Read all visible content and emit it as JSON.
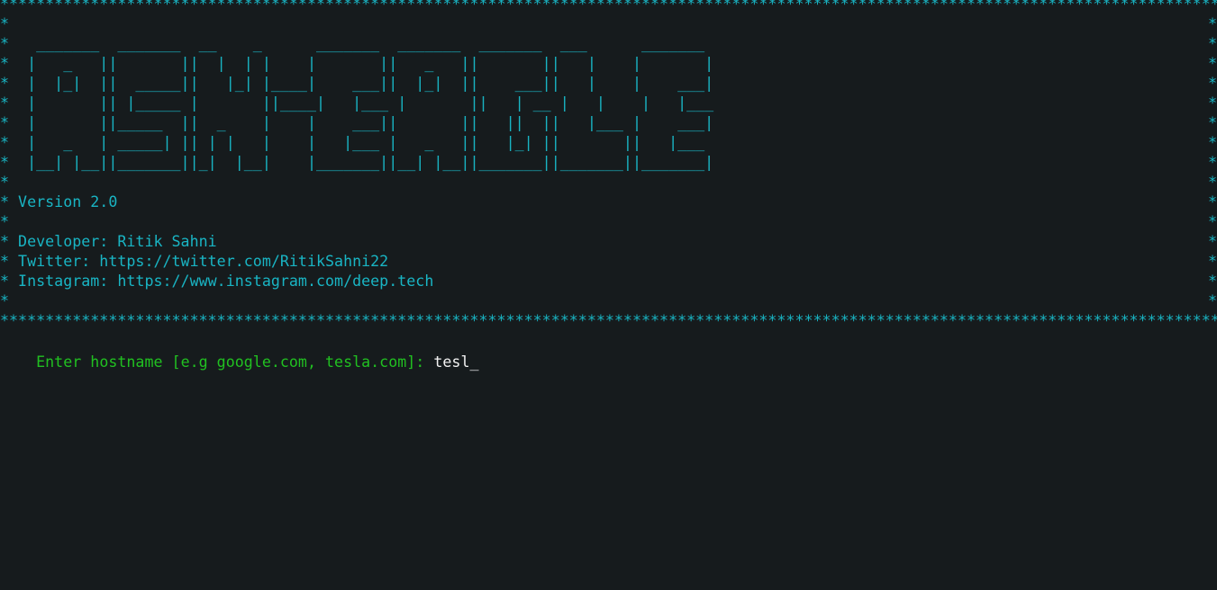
{
  "terminal": {
    "border_line": "*********************************************************************************************************************************************",
    "border_char": "*",
    "banner": [
      "",
      "   _______  _______  __    _      _______  _______  _______  ___      _______",
      "  |   _   ||       ||  |  | |    |       ||   _   ||       ||   |    |       |",
      "  |  |_|  ||  _____||   |_| |____|    ___||  |_|  ||    ___||   |    |    ___|",
      "  |       || |_____ |       ||____|   |___ |       ||   | __ |   |    |   |___",
      "  |       ||_____  ||  _    |    |    ___||       ||   ||  ||   |___ |    ___|",
      "  |   _   | _____| || | |   |    |   |___ |   _   ||   |_| ||       ||   |___",
      "  |__| |__||_______||_|  |__|    |_______||__| |__||_______||_______||_______|",
      "",
      " Version 2.0",
      "",
      " Developer: Ritik Sahni",
      " Twitter: https://twitter.com/RitikSahni22",
      " Instagram: https://www.instagram.com/deep.tech",
      ""
    ],
    "prompt": {
      "label": "Enter hostname [e.g google.com, tesla.com]: ",
      "value": "tesl",
      "cursor": "_"
    },
    "colors": {
      "background": "#161b1d",
      "banner": "#19b5c4",
      "prompt": "#21c021",
      "input": "#f2f2f2"
    }
  }
}
